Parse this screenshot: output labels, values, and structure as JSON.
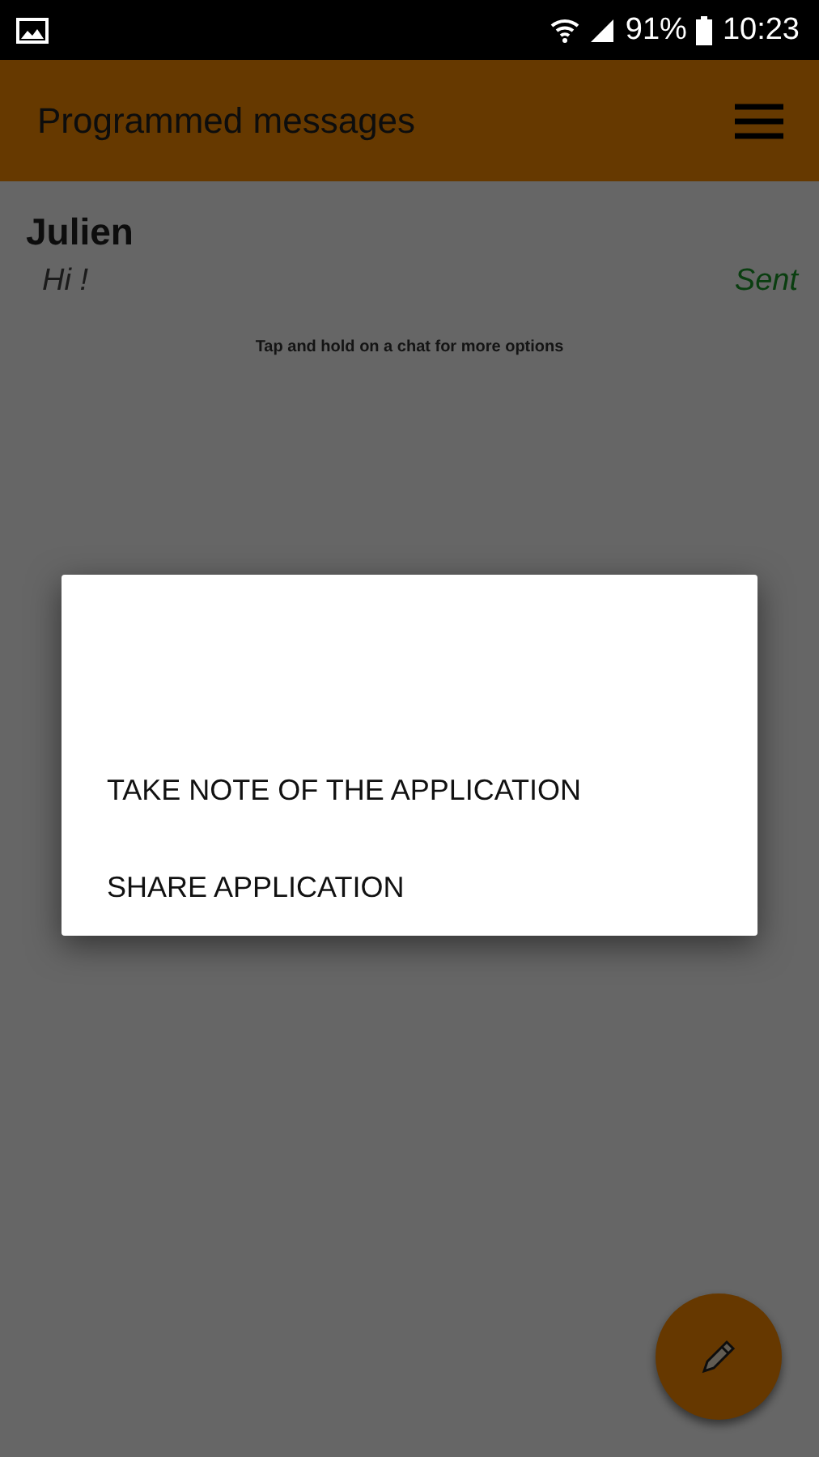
{
  "status_bar": {
    "battery": "91%",
    "time": "10:23"
  },
  "app_bar": {
    "title": "Programmed messages"
  },
  "chats": [
    {
      "name": "Julien",
      "message": "Hi !",
      "status": "Sent"
    }
  ],
  "hint": "Tap and hold on a chat for more options",
  "dialog": {
    "items": [
      "TAKE NOTE OF THE APPLICATION",
      "SHARE APPLICATION"
    ]
  }
}
